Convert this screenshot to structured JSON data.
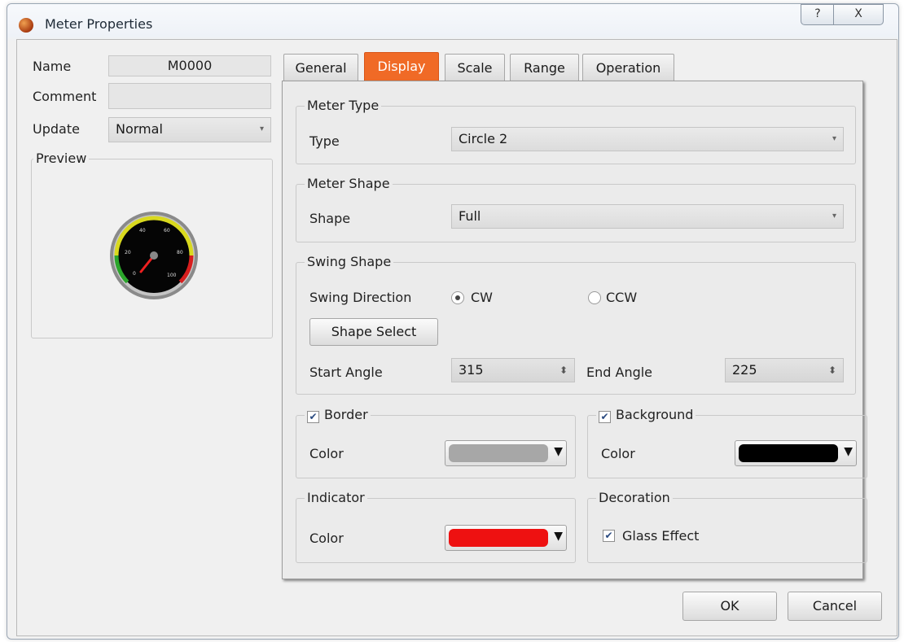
{
  "window": {
    "title": "Meter Properties",
    "help_glyph": "?",
    "close_glyph": "X"
  },
  "left": {
    "name_label": "Name",
    "name_value": "M0000",
    "comment_label": "Comment",
    "comment_value": "",
    "update_label": "Update",
    "update_value": "Normal",
    "preview_title": "Preview",
    "gauge_ticks": [
      "0",
      "20",
      "40",
      "60",
      "80",
      "100"
    ]
  },
  "tabs": [
    {
      "label": "General",
      "active": false
    },
    {
      "label": "Display",
      "active": true
    },
    {
      "label": "Scale",
      "active": false
    },
    {
      "label": "Range",
      "active": false
    },
    {
      "label": "Operation",
      "active": false
    }
  ],
  "display": {
    "meter_type": {
      "title": "Meter Type",
      "label": "Type",
      "value": "Circle 2"
    },
    "meter_shape": {
      "title": "Meter Shape",
      "label": "Shape",
      "value": "Full"
    },
    "swing": {
      "title": "Swing Shape",
      "direction_label": "Swing Direction",
      "cw_label": "CW",
      "ccw_label": "CCW",
      "selected": "CW",
      "shape_select_label": "Shape Select",
      "start_label": "Start Angle",
      "start_value": "315",
      "end_label": "End Angle",
      "end_value": "225"
    },
    "border": {
      "title": "Border",
      "checked": true,
      "color_label": "Color",
      "color": "#a7a7a7"
    },
    "background": {
      "title": "Background",
      "checked": true,
      "color_label": "Color",
      "color": "#000000"
    },
    "indicator": {
      "title": "Indicator",
      "color_label": "Color",
      "color": "#ee1111"
    },
    "decoration": {
      "title": "Decoration",
      "glass_label": "Glass Effect",
      "glass_checked": true
    }
  },
  "footer": {
    "ok_label": "OK",
    "cancel_label": "Cancel"
  },
  "icons": {
    "dropdown": "▾",
    "spin": "⬍",
    "color_caret": "▼",
    "check": "✔"
  }
}
